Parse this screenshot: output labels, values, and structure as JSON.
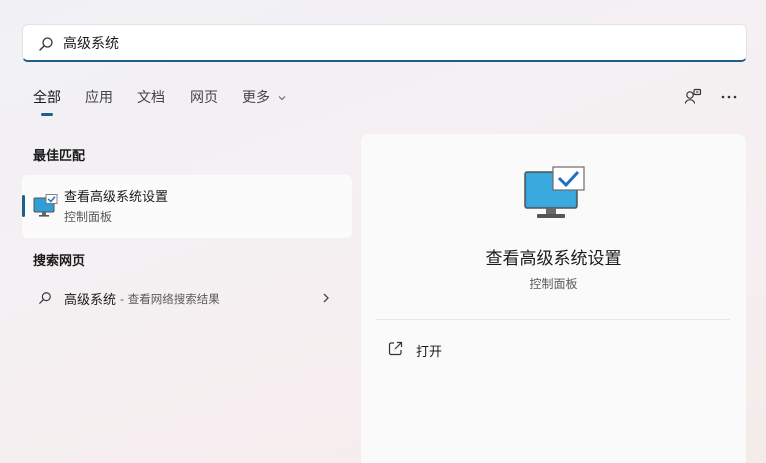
{
  "search": {
    "value": "高级系统",
    "placeholder": ""
  },
  "tabs": [
    {
      "label": "全部",
      "active": true
    },
    {
      "label": "应用"
    },
    {
      "label": "文档"
    },
    {
      "label": "网页"
    },
    {
      "label": "更多"
    }
  ],
  "header_icons": [
    "account-switch-icon",
    "more-options-icon"
  ],
  "best_match": {
    "section_title": "最佳匹配",
    "title": "查看高级系统设置",
    "subtitle": "控制面板",
    "icon": "system-monitor-checkmark-icon"
  },
  "web": {
    "section_title": "搜索网页",
    "query": "高级系统",
    "suffix": "- 查看网络搜索结果"
  },
  "preview": {
    "title": "查看高级系统设置",
    "subtitle": "控制面板",
    "action_label": "打开",
    "action_icon": "open-external-icon"
  },
  "colors": {
    "accent": "#1f5f8a",
    "monitor_screen": "#2f9fd6",
    "checkmark": "#1f6fc4"
  }
}
